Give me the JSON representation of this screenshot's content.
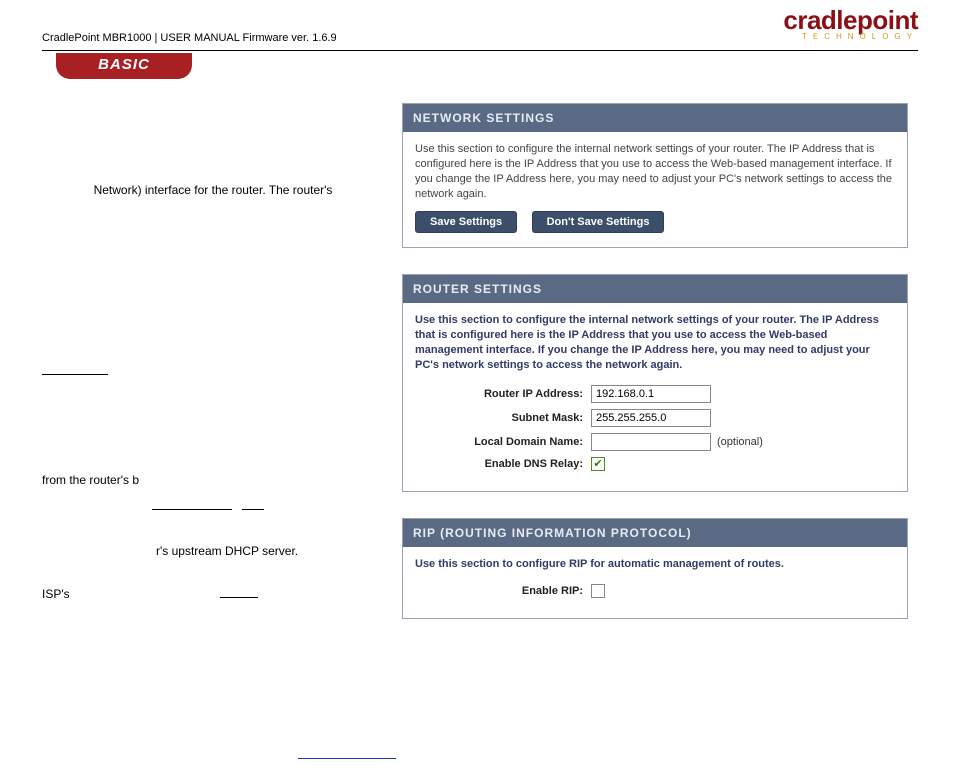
{
  "logo": {
    "main": "cradlepoint",
    "sub": "TECHNOLOGY"
  },
  "doc_title": "CradlePoint MBR1000 | USER MANUAL Firmware ver. 1.6.9",
  "tab_label": "BASIC",
  "left": {
    "line1": "Network) interface for the router. The router's",
    "line2_pre": "from the router's b",
    "line3": "r's upstream DHCP server.",
    "line4": "ISP's"
  },
  "panels": {
    "network": {
      "title": "NETWORK SETTINGS",
      "desc": "Use this section to configure the internal network settings of your router. The IP Address that is configured here is the IP Address that you use to access the Web-based management interface. If you change the IP Address here, you may need to adjust your PC's network settings to access the network again.",
      "save": "Save Settings",
      "dont": "Don't Save Settings"
    },
    "router": {
      "title": "ROUTER SETTINGS",
      "desc": "Use this section to configure the internal network settings of your router. The IP Address that is configured here is the IP Address that you use to access the Web-based management interface. If you change the IP Address here, you may need to adjust your PC's network settings to access the network again.",
      "fields": {
        "ip_label": "Router IP Address:",
        "ip_value": "192.168.0.1",
        "mask_label": "Subnet Mask:",
        "mask_value": "255.255.255.0",
        "domain_label": "Local Domain Name:",
        "domain_value": "",
        "domain_opt": "(optional)",
        "dns_label": "Enable DNS Relay:",
        "dns_checked": true
      }
    },
    "rip": {
      "title": "RIP (ROUTING INFORMATION PROTOCOL)",
      "desc": "Use this section to configure RIP for automatic management of routes.",
      "label": "Enable RIP:",
      "checked": false
    }
  }
}
